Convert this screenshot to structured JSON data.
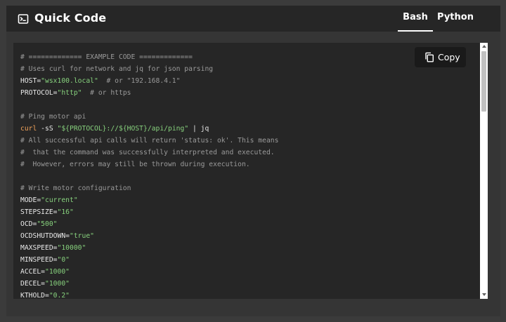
{
  "header": {
    "title": "Quick Code",
    "icon": "terminal-icon"
  },
  "tabs": [
    {
      "label": "Bash",
      "active": true
    },
    {
      "label": "Python",
      "active": false
    }
  ],
  "copy_button": {
    "label": "Copy",
    "icon": "copy-icon"
  },
  "code": {
    "language": "bash",
    "lines": [
      [
        {
          "t": "c",
          "v": "# ============= EXAMPLE CODE ============="
        }
      ],
      [
        {
          "t": "c",
          "v": "# Uses curl for network and jq for json parsing"
        }
      ],
      [
        {
          "t": "v",
          "v": "HOST="
        },
        {
          "t": "s",
          "v": "\"wsx100.local\""
        },
        {
          "t": "c",
          "v": "  # or \"192.168.4.1\""
        }
      ],
      [
        {
          "t": "v",
          "v": "PROTOCOL="
        },
        {
          "t": "s",
          "v": "\"http\""
        },
        {
          "t": "c",
          "v": "  # or https"
        }
      ],
      [],
      [
        {
          "t": "c",
          "v": "# Ping motor api"
        }
      ],
      [
        {
          "t": "k",
          "v": "curl"
        },
        {
          "t": "v",
          "v": " -sS "
        },
        {
          "t": "s",
          "v": "\"${PROTOCOL}://${HOST}/api/ping\""
        },
        {
          "t": "v",
          "v": " | jq"
        }
      ],
      [
        {
          "t": "c",
          "v": "# All successful api calls will return 'status: ok'. This means"
        }
      ],
      [
        {
          "t": "c",
          "v": "#  that the command was successfully interpreted and executed."
        }
      ],
      [
        {
          "t": "c",
          "v": "#  However, errors may still be thrown during execution."
        }
      ],
      [],
      [
        {
          "t": "c",
          "v": "# Write motor configuration"
        }
      ],
      [
        {
          "t": "v",
          "v": "MODE="
        },
        {
          "t": "s",
          "v": "\"current\""
        }
      ],
      [
        {
          "t": "v",
          "v": "STEPSIZE="
        },
        {
          "t": "s",
          "v": "\"16\""
        }
      ],
      [
        {
          "t": "v",
          "v": "OCD="
        },
        {
          "t": "s",
          "v": "\"500\""
        }
      ],
      [
        {
          "t": "v",
          "v": "OCDSHUTDOWN="
        },
        {
          "t": "s",
          "v": "\"true\""
        }
      ],
      [
        {
          "t": "v",
          "v": "MAXSPEED="
        },
        {
          "t": "s",
          "v": "\"10000\""
        }
      ],
      [
        {
          "t": "v",
          "v": "MINSPEED="
        },
        {
          "t": "s",
          "v": "\"0\""
        }
      ],
      [
        {
          "t": "v",
          "v": "ACCEL="
        },
        {
          "t": "s",
          "v": "\"1000\""
        }
      ],
      [
        {
          "t": "v",
          "v": "DECEL="
        },
        {
          "t": "s",
          "v": "\"1000\""
        }
      ],
      [
        {
          "t": "v",
          "v": "KTHOLD="
        },
        {
          "t": "s",
          "v": "\"0.2\""
        }
      ]
    ]
  },
  "colors": {
    "background": "#3b3b3b",
    "card": "#353535",
    "header": "#262626",
    "code_bg": "#262626",
    "comment": "#9a9a9a",
    "string": "#87d17d",
    "command": "#f2a35a",
    "text": "#e9e9e9"
  }
}
